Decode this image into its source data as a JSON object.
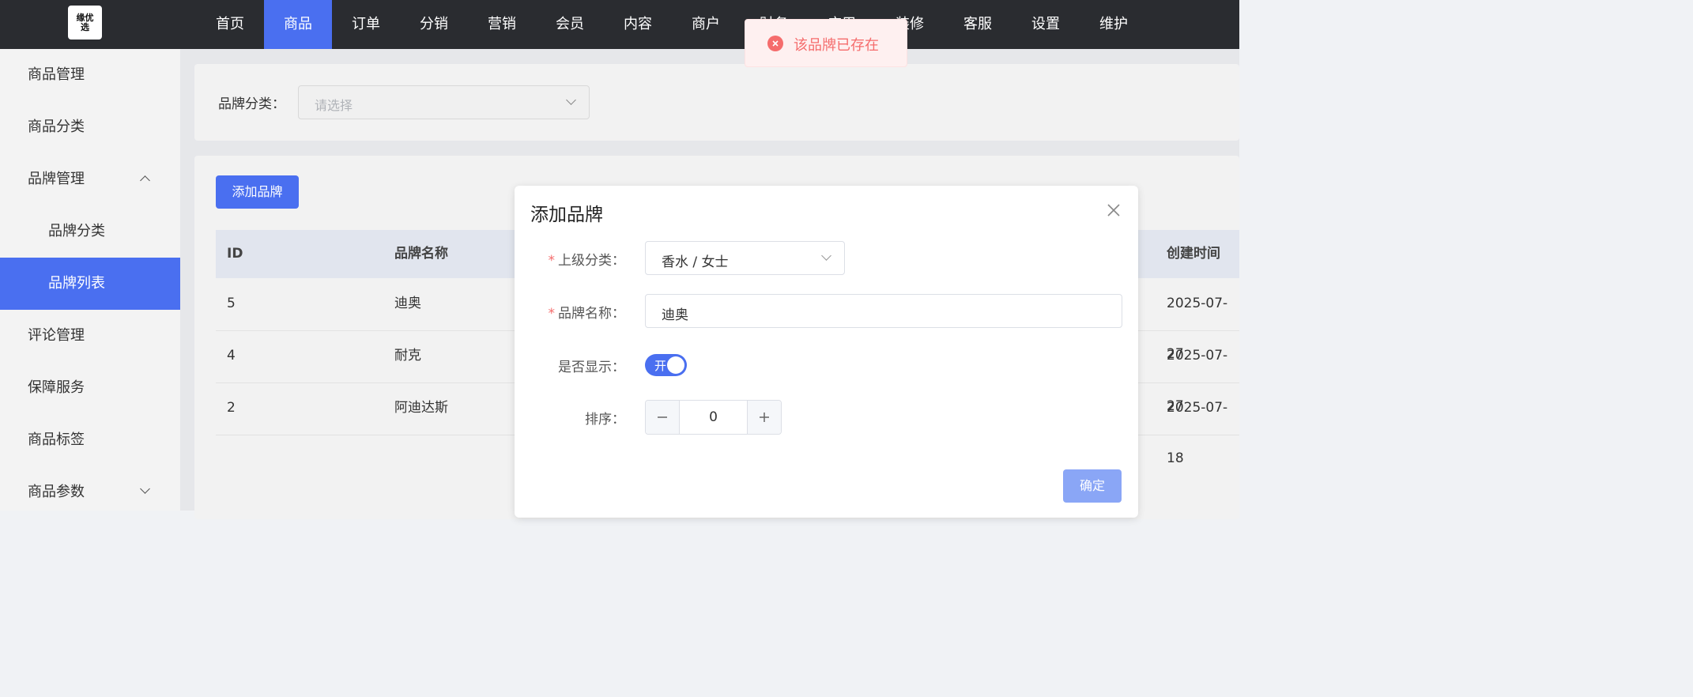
{
  "logo": {
    "text": "缘优选"
  },
  "nav": {
    "items": [
      {
        "label": "首页",
        "active": false
      },
      {
        "label": "商品",
        "active": true
      },
      {
        "label": "订单",
        "active": false
      },
      {
        "label": "分销",
        "active": false
      },
      {
        "label": "营销",
        "active": false
      },
      {
        "label": "会员",
        "active": false
      },
      {
        "label": "内容",
        "active": false
      },
      {
        "label": "商户",
        "active": false
      },
      {
        "label": "财务",
        "active": false
      },
      {
        "label": "应用",
        "active": false
      },
      {
        "label": "装修",
        "active": false
      },
      {
        "label": "客服",
        "active": false
      },
      {
        "label": "设置",
        "active": false
      },
      {
        "label": "维护",
        "active": false
      }
    ]
  },
  "sidebar": {
    "items": [
      {
        "label": "商品管理"
      },
      {
        "label": "商品分类"
      },
      {
        "label": "品牌管理",
        "expanded": true
      },
      {
        "label": "品牌分类"
      },
      {
        "label": "品牌列表",
        "active": true
      },
      {
        "label": "评论管理"
      },
      {
        "label": "保障服务"
      },
      {
        "label": "商品标签"
      },
      {
        "label": "商品参数",
        "expanded": false
      }
    ]
  },
  "filter": {
    "label": "品牌分类：",
    "placeholder": "请选择"
  },
  "table": {
    "add_button": "添加品牌",
    "headers": {
      "id": "ID",
      "name": "品牌名称",
      "created": "创建时间"
    },
    "rows": [
      {
        "id": "5",
        "name": "迪奥",
        "created": "2025-07-27"
      },
      {
        "id": "4",
        "name": "耐克",
        "created": "2025-07-27"
      },
      {
        "id": "2",
        "name": "阿迪达斯",
        "created": "2025-07-18"
      }
    ]
  },
  "dialog": {
    "title": "添加品牌",
    "parent_label": "上级分类：",
    "parent_value": "香水 / 女士",
    "name_label": "品牌名称：",
    "name_value": "迪奥",
    "show_label": "是否显示：",
    "show_switch_text": "开",
    "show_switch_on": true,
    "sort_label": "排序：",
    "sort_value": "0",
    "confirm_button": "确定",
    "required_mark": "*"
  },
  "toast": {
    "message": "该品牌已存在",
    "type": "error"
  },
  "colors": {
    "accent": "#4a6ff0",
    "topbar": "#2a2c30",
    "error": "#f56c6c"
  }
}
